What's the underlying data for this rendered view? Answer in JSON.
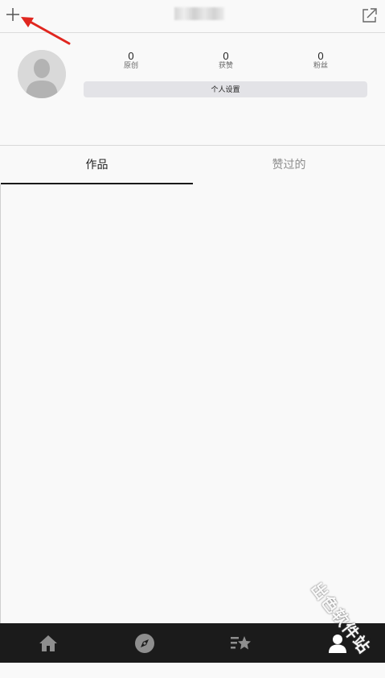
{
  "header": {
    "add_icon": "plus-icon",
    "share_icon": "share-icon"
  },
  "profile": {
    "stats": [
      {
        "value": "0",
        "label": "原创"
      },
      {
        "value": "0",
        "label": "获赞"
      },
      {
        "value": "0",
        "label": "粉丝"
      }
    ],
    "settings_label": "个人设置"
  },
  "tabs": [
    {
      "label": "作品",
      "active": true
    },
    {
      "label": "赞过的",
      "active": false
    }
  ],
  "tabbar": [
    {
      "icon": "home-icon",
      "active": false
    },
    {
      "icon": "compass-icon",
      "active": false
    },
    {
      "icon": "starred-list-icon",
      "active": false
    },
    {
      "icon": "user-icon",
      "active": true
    }
  ],
  "colors": {
    "annotation_arrow": "#e0261f",
    "tabbar_bg": "#1b1b1b",
    "page_bg": "#f9f9f9"
  },
  "watermark": "出色软件站"
}
